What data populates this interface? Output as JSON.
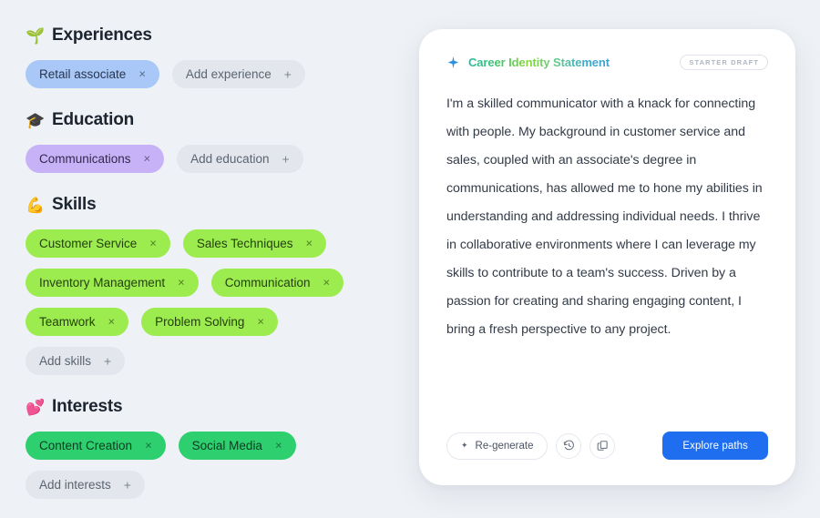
{
  "profile": {
    "sections": [
      {
        "key": "experiences",
        "icon": "seedling-icon",
        "emoji": "🌱",
        "title": "Experiences",
        "chip_style": "c-blue",
        "chips": [
          {
            "label": "Retail associate",
            "remove": "×"
          }
        ],
        "add": {
          "label": "Add experience",
          "plus": "+"
        }
      },
      {
        "key": "education",
        "icon": "graduation-cap-icon",
        "emoji": "🎓",
        "title": "Education",
        "chip_style": "c-purple",
        "chips": [
          {
            "label": "Communications",
            "remove": "×"
          }
        ],
        "add": {
          "label": "Add education",
          "plus": "+"
        }
      },
      {
        "key": "skills",
        "icon": "flexed-biceps-icon",
        "emoji": "💪",
        "title": "Skills",
        "chip_style": "c-lime",
        "chips": [
          {
            "label": "Customer Service",
            "remove": "×"
          },
          {
            "label": "Sales Techniques",
            "remove": "×"
          },
          {
            "label": "Inventory Management",
            "remove": "×"
          },
          {
            "label": "Communication",
            "remove": "×"
          },
          {
            "label": "Teamwork",
            "remove": "×"
          },
          {
            "label": "Problem Solving",
            "remove": "×"
          }
        ],
        "add": {
          "label": "Add skills",
          "plus": "+"
        }
      },
      {
        "key": "interests",
        "icon": "two-hearts-icon",
        "emoji": "💕",
        "title": "Interests",
        "chip_style": "c-green",
        "chips": [
          {
            "label": "Content Creation",
            "remove": "×"
          },
          {
            "label": "Social Media",
            "remove": "×"
          }
        ],
        "add": {
          "label": "Add interests",
          "plus": "+"
        }
      }
    ]
  },
  "card": {
    "title": "Career Identity Statement",
    "badge": "STARTER DRAFT",
    "statement": "I'm a skilled communicator with a knack for connecting with people. My background in customer service and sales, coupled with an associate's degree in communications, has allowed me to hone my abilities in understanding and addressing individual needs. I thrive in collaborative environments where I can leverage my skills to contribute to a team's success. Driven by a passion for creating and sharing engaging content, I bring a fresh perspective to any project.",
    "actions": {
      "regenerate_label": "Re-generate",
      "regenerate_sparkle": "✦",
      "history_icon": "history-icon",
      "copy_icon": "copy-icon",
      "primary_label": "Explore paths"
    }
  },
  "colors": {
    "page_background": "#eef1f5",
    "card_background": "#ffffff",
    "accent_primary": "#1f6ef0",
    "chip_blue": "#a9c8f7",
    "chip_purple": "#c8b2f7",
    "chip_lime": "#9cec4f",
    "chip_green": "#2dcf6f",
    "chip_add": "#e3e6ec",
    "title_gradient_start": "#2bb6a3",
    "title_gradient_mid": "#86d63c",
    "title_gradient_end": "#3f9fd4"
  }
}
